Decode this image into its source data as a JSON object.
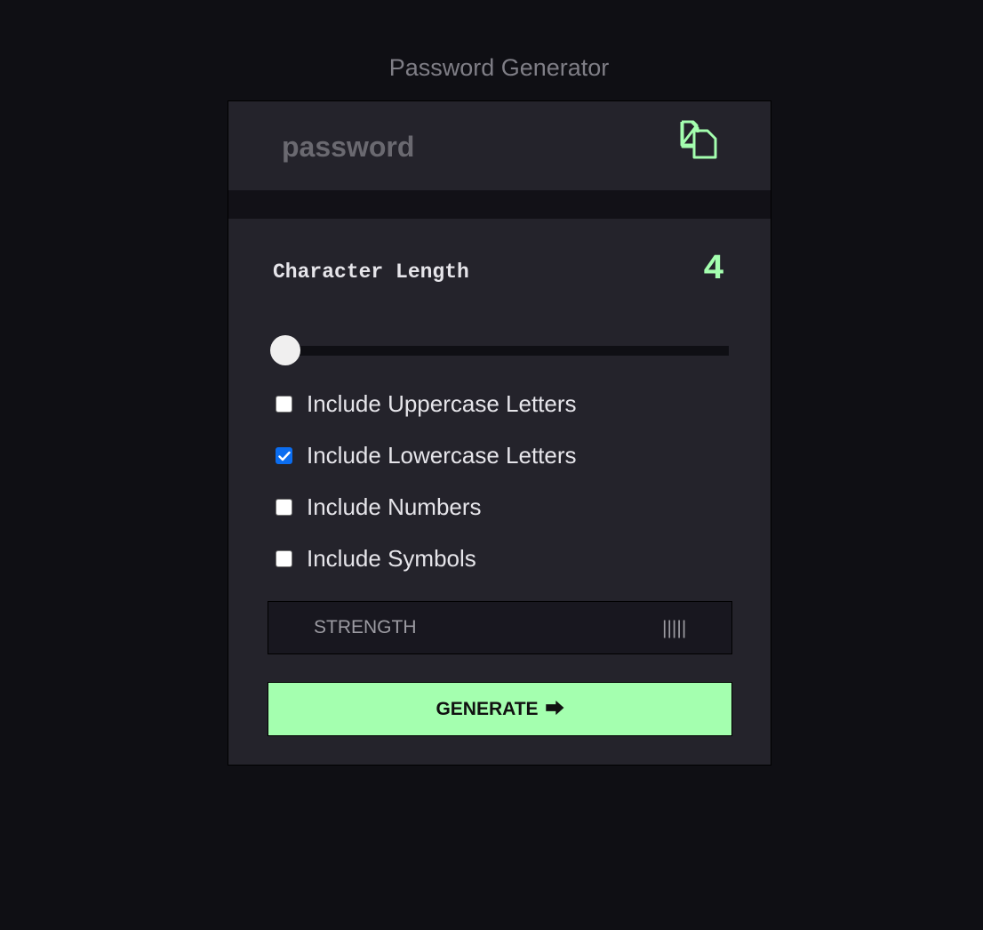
{
  "app": {
    "title": "Password Generator"
  },
  "password": {
    "value": "password",
    "copy_icon": "copy-icon"
  },
  "length": {
    "label": "Character Length",
    "value": "4",
    "slider_fraction": 0.0
  },
  "options": [
    {
      "label": "Include Uppercase Letters",
      "checked": false
    },
    {
      "label": "Include Lowercase Letters",
      "checked": true
    },
    {
      "label": "Include Numbers",
      "checked": false
    },
    {
      "label": "Include Symbols",
      "checked": false
    }
  ],
  "strength": {
    "label": "STRENGTH",
    "meter": "|||||"
  },
  "generate": {
    "label": "GENERATE",
    "arrow": "⮕"
  },
  "colors": {
    "accent": "#a4ffaf",
    "background": "#0f0f14",
    "card": "#24232b",
    "checkbox_checked": "#0b6df0"
  }
}
